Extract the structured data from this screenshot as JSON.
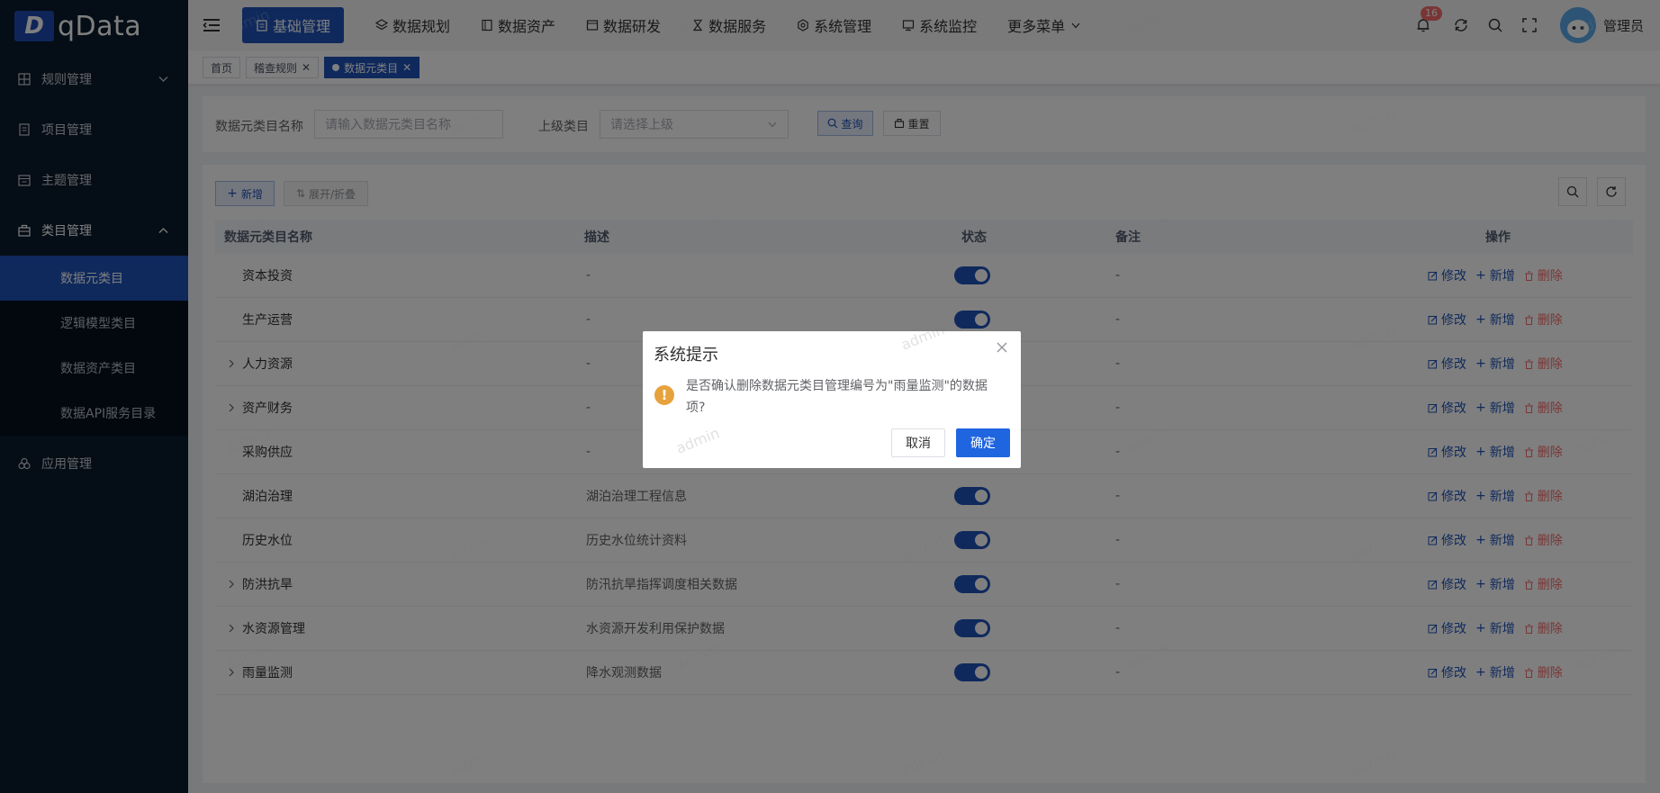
{
  "app": {
    "logo_mark": "D",
    "logo_text": "qData"
  },
  "sidebar": {
    "items": [
      {
        "label": "规则管理",
        "icon": "grid-icon"
      },
      {
        "label": "项目管理",
        "icon": "document-icon"
      },
      {
        "label": "主题管理",
        "icon": "calendar-icon"
      },
      {
        "label": "类目管理",
        "icon": "briefcase-icon"
      },
      {
        "label": "应用管理",
        "icon": "apps-icon"
      }
    ],
    "sub_items": [
      "数据元类目",
      "逻辑模型类目",
      "数据资产类目",
      "数据API服务目录"
    ]
  },
  "topnav": {
    "items": [
      "基础管理",
      "数据规划",
      "数据资产",
      "数据研发",
      "数据服务",
      "系统管理",
      "系统监控",
      "更多菜单"
    ],
    "notification_count": "16",
    "user_name": "管理员"
  },
  "tags": {
    "home": "首页",
    "audit": "稽查规则",
    "current": "数据元类目"
  },
  "search": {
    "name_label": "数据元类目名称",
    "name_placeholder": "请输入数据元类目名称",
    "parent_label": "上级类目",
    "parent_placeholder": "请选择上级",
    "query_label": "查询",
    "reset_label": "重置"
  },
  "toolbar": {
    "add_label": "新增",
    "expand_label": "展开/折叠"
  },
  "table": {
    "headers": [
      "数据元类目名称",
      "描述",
      "状态",
      "备注",
      "操作"
    ],
    "action_labels": {
      "edit": "修改",
      "add": "新增",
      "delete": "删除"
    },
    "rows": [
      {
        "name": "资本投资",
        "desc": "-",
        "remark": "-",
        "expandable": false,
        "enabled": true
      },
      {
        "name": "生产运营",
        "desc": "-",
        "remark": "-",
        "expandable": false,
        "enabled": true
      },
      {
        "name": "人力资源",
        "desc": "-",
        "remark": "-",
        "expandable": true,
        "enabled": true
      },
      {
        "name": "资产财务",
        "desc": "-",
        "remark": "-",
        "expandable": true,
        "enabled": true
      },
      {
        "name": "采购供应",
        "desc": "-",
        "remark": "-",
        "expandable": false,
        "enabled": true
      },
      {
        "name": "湖泊治理",
        "desc": "湖泊治理工程信息",
        "remark": "-",
        "expandable": false,
        "enabled": true
      },
      {
        "name": "历史水位",
        "desc": "历史水位统计资料",
        "remark": "-",
        "expandable": false,
        "enabled": true
      },
      {
        "name": "防洪抗旱",
        "desc": "防汛抗旱指挥调度相关数据",
        "remark": "-",
        "expandable": true,
        "enabled": true
      },
      {
        "name": "水资源管理",
        "desc": "水资源开发利用保护数据",
        "remark": "-",
        "expandable": true,
        "enabled": true
      },
      {
        "name": "雨量监测",
        "desc": "降水观测数据",
        "remark": "-",
        "expandable": true,
        "enabled": true
      }
    ]
  },
  "dialog": {
    "title": "系统提示",
    "message": "是否确认删除数据元类目管理编号为\"雨量监测\"的数据项?",
    "cancel_label": "取消",
    "confirm_label": "确定"
  },
  "watermark": "admin",
  "colors": {
    "primary": "#1f52b8",
    "sidebar_bg": "#0b1a2c",
    "danger": "#f56c6c",
    "warning": "#e6a23c"
  }
}
